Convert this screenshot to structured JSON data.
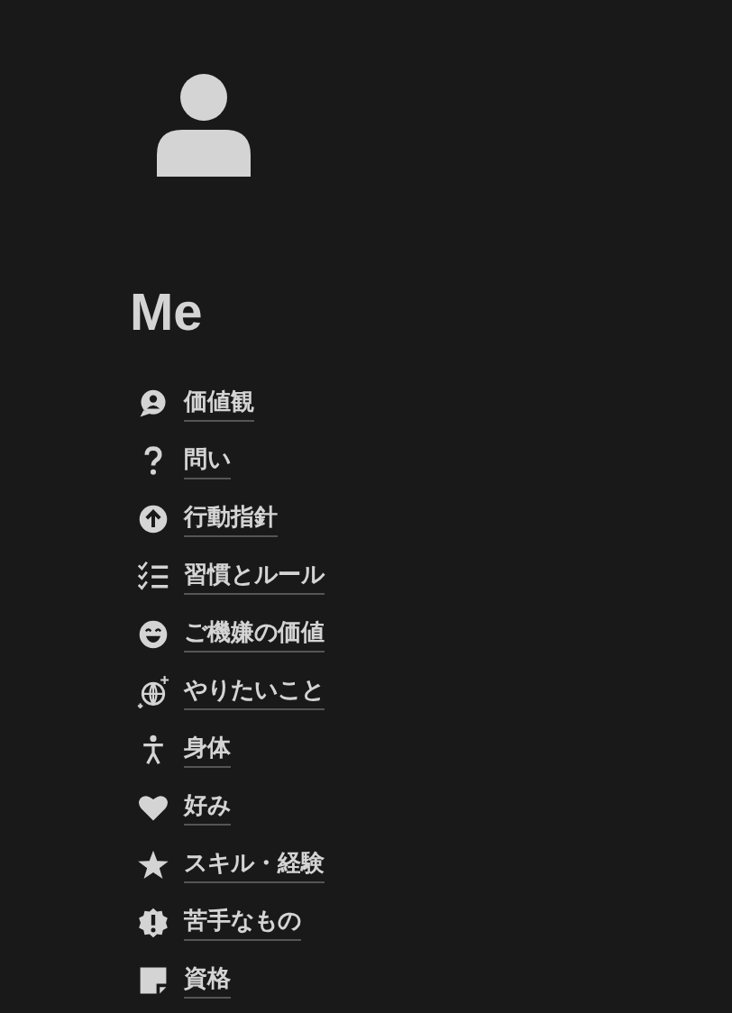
{
  "page": {
    "title": "Me"
  },
  "links": [
    {
      "label": "価値観"
    },
    {
      "label": "問い"
    },
    {
      "label": "行動指針"
    },
    {
      "label": "習慣とルール"
    },
    {
      "label": "ご機嫌の価値"
    },
    {
      "label": "やりたいこと"
    },
    {
      "label": "身体"
    },
    {
      "label": "好み"
    },
    {
      "label": "スキル・経験"
    },
    {
      "label": "苦手なもの"
    },
    {
      "label": "資格"
    }
  ]
}
